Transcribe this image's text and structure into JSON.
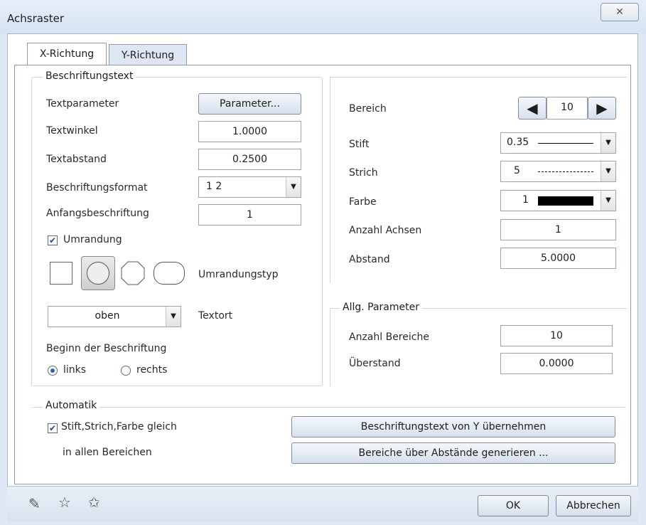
{
  "window": {
    "title": "Achsraster",
    "close_glyph": "✕"
  },
  "tabs": [
    {
      "label": "X-Richtung",
      "active": true
    },
    {
      "label": "Y-Richtung",
      "active": false
    }
  ],
  "beschriftung": {
    "legend": "Beschriftungstext",
    "textparameter_label": "Textparameter",
    "parameter_button": "Parameter...",
    "textwinkel_label": "Textwinkel",
    "textwinkel_value": "1.0000",
    "textabstand_label": "Textabstand",
    "textabstand_value": "0.2500",
    "format_label": "Beschriftungsformat",
    "format_value": "1  2",
    "anfang_label": "Anfangsbeschriftung",
    "anfang_value": "1",
    "umrandung_label": "Umrandung",
    "umrandung_checked": true,
    "umrandungstyp_label": "Umrandungstyp",
    "textort_value": "oben",
    "textort_label": "Textort",
    "beginn_label": "Beginn der Beschriftung",
    "radio_links": "links",
    "radio_rechts": "rechts",
    "selected": "links"
  },
  "bereich": {
    "label": "Bereich",
    "value": "10",
    "stift_label": "Stift",
    "stift_value": "0.35",
    "strich_label": "Strich",
    "strich_value": "5",
    "farbe_label": "Farbe",
    "farbe_value": "1",
    "farbe_color": "#000000",
    "anzahl_achsen_label": "Anzahl Achsen",
    "anzahl_achsen_value": "1",
    "abstand_label": "Abstand",
    "abstand_value": "5.0000"
  },
  "allg": {
    "legend": "Allg. Parameter",
    "anzahl_bereiche_label": "Anzahl Bereiche",
    "anzahl_bereiche_value": "10",
    "ueberstand_label": "Überstand",
    "ueberstand_value": "0.0000"
  },
  "automatik": {
    "legend": "Automatik",
    "check_label": "Stift,Strich,Farbe gleich",
    "checked": true,
    "sub_label": "in allen Bereichen",
    "btn_uebernehmen": "Beschriftungstext von Y übernehmen",
    "btn_generieren": "Bereiche über Abstände generieren ..."
  },
  "footer": {
    "ok": "OK",
    "cancel": "Abbrechen"
  }
}
